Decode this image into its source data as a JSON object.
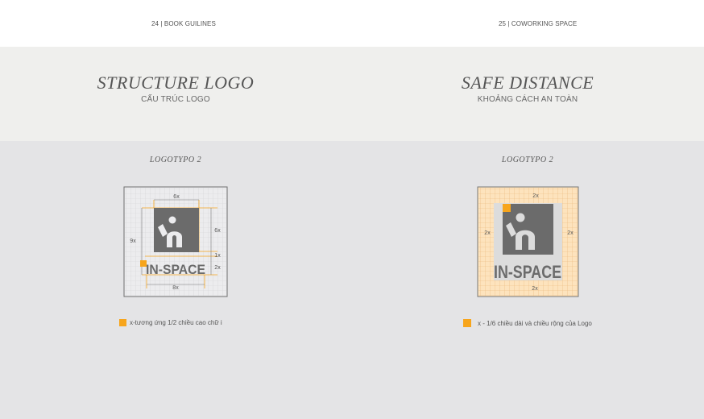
{
  "header": {
    "left": "24 | BOOK GUILINES",
    "right": "25 | COWORKING SPACE"
  },
  "left_page": {
    "title": "STRUCTURE LOGO",
    "subtitle": "CẤU TRÚC LOGO",
    "section": "LOGOTYPO 2",
    "logo_text": "IN-SPACE",
    "dimensions": {
      "top": "6x",
      "left": "9x",
      "right_mark": "6x",
      "right_gap": "1x",
      "right_text": "2x",
      "bottom": "8x"
    },
    "legend": "x-tương ứng 1/2 chiều cao chữ i"
  },
  "right_page": {
    "title": "SAFE DISTANCE",
    "subtitle": "KHOẢNG CÁCH AN TOÀN",
    "section": "LOGOTYPO 2",
    "logo_text": "IN-SPACE",
    "dimensions": {
      "top": "2x",
      "left": "2x",
      "right": "2x",
      "bottom": "2x"
    },
    "legend": "x - 1/6 chiều dài và chiều rộng của Logo"
  },
  "colors": {
    "accent": "#f7a51c",
    "logo": "#6b6b6b",
    "safe_area": "#fde3bd"
  }
}
